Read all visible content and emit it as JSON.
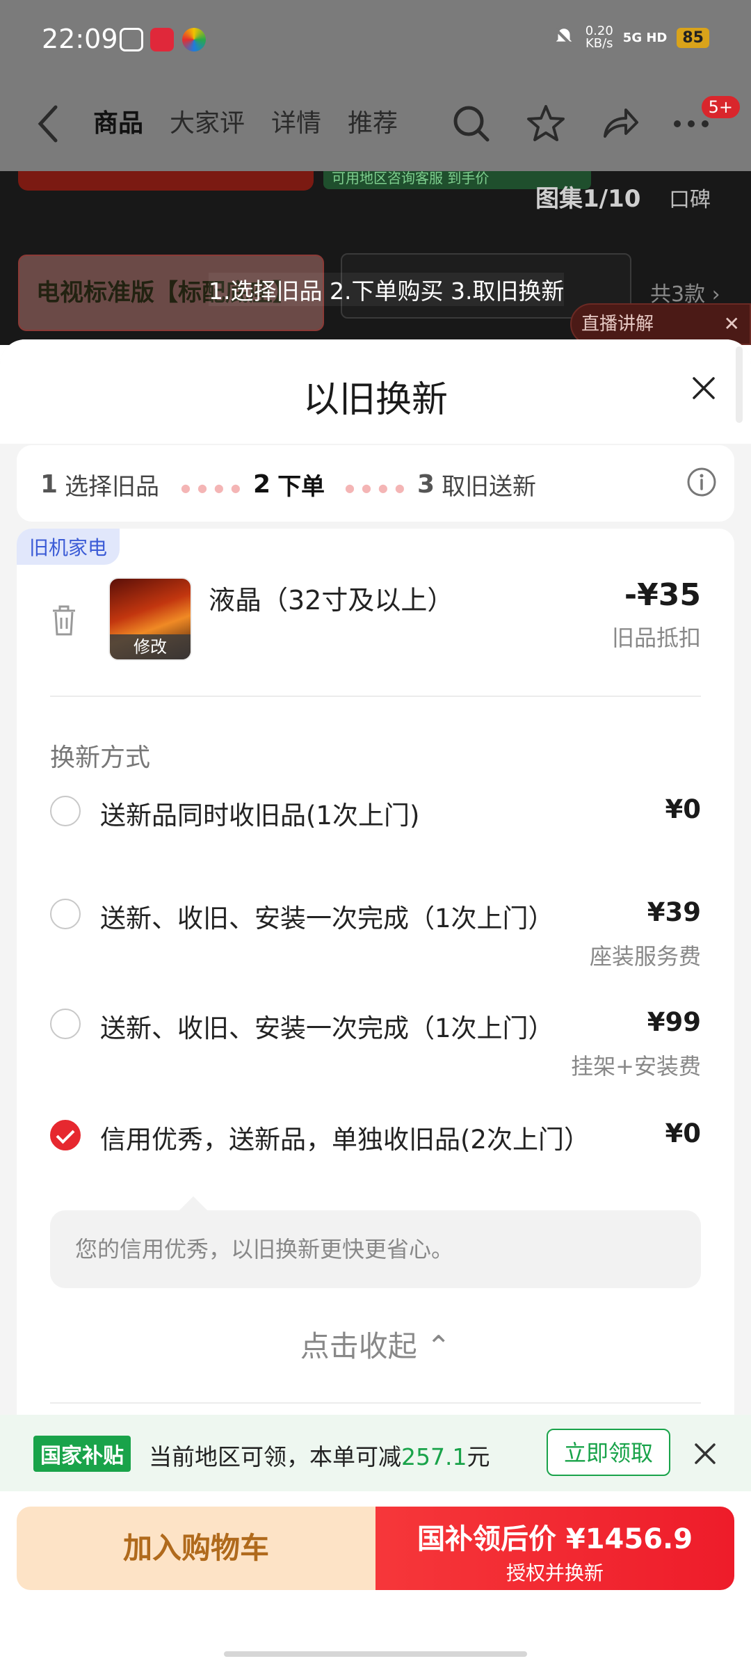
{
  "status_bar": {
    "time": "22:09",
    "net_speed": "0.20",
    "net_unit": "KB/s",
    "signal": "5G HD",
    "battery": "85"
  },
  "nav": {
    "tabs": [
      "商品",
      "大家评",
      "详情",
      "推荐"
    ],
    "more_badge": "5+"
  },
  "product_bg": {
    "green_strip": "可用地区咨询客服     到手价",
    "album": "图集1/10",
    "koubei": "口碑",
    "variant_label": "电视标准版【标配底座】",
    "variant_count": "共3款 ›",
    "toast": "1.选择旧品 2.下单购买 3.取旧换新",
    "live": "直播讲解"
  },
  "sheet": {
    "title": "以旧换新",
    "steps": [
      {
        "num": "1",
        "label": "选择旧品"
      },
      {
        "num": "2",
        "label": "下单"
      },
      {
        "num": "3",
        "label": "取旧送新"
      }
    ],
    "category_tag": "旧机家电",
    "item": {
      "name": "液晶（32寸及以上）",
      "edit": "修改",
      "price": "-¥35",
      "price_note": "旧品抵扣"
    },
    "method_title": "换新方式",
    "options": [
      {
        "label": "送新品同时收旧品(1次上门)",
        "price": "¥0",
        "note": ""
      },
      {
        "label": "送新、收旧、安装一次完成（1次上门）",
        "price": "¥39",
        "note": "座装服务费"
      },
      {
        "label": "送新、收旧、安装一次完成（1次上门）",
        "price": "¥99",
        "note": "挂架+安装费"
      },
      {
        "label": "信用优秀，送新品，单独收旧品(2次上门）",
        "price": "¥0",
        "note": ""
      }
    ],
    "selected_option": 3,
    "hint": "您的信用优秀，以旧换新更快更省心。",
    "collapse": "点击收起 ⌃"
  },
  "subsidy": {
    "tag": "国家补贴",
    "text_pre": "当前地区可领，本单可减",
    "amount": "257.1",
    "text_post": "元",
    "button": "立即领取"
  },
  "actions": {
    "cart": "加入购物车",
    "buy_main": "国补领后价 ¥1456.9",
    "buy_sub": "授权并换新"
  },
  "colors": {
    "accent_red": "#e6282f",
    "subsidy_green": "#19a34a",
    "tag_blue": "#3b5bd6"
  }
}
